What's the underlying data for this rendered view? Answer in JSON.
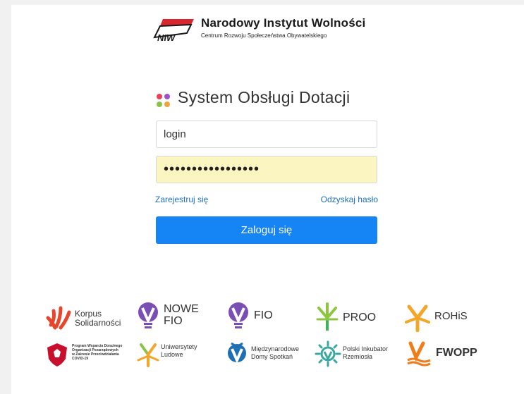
{
  "header": {
    "org_title": "Narodowy Instytut Wolności",
    "org_subtitle": "Centrum Rozwoju Społeczeństwa Obywatelskiego",
    "logo_text": "NIW"
  },
  "app": {
    "title": "System Obsługi Dotacji",
    "dot_colors": [
      "#e8425b",
      "#9d4fd4",
      "#8bc34a",
      "#f2a33a"
    ]
  },
  "form": {
    "login_value": "login",
    "password_value": "•••••••••••••••••",
    "register_link": "Zarejestruj się",
    "recover_link": "Odzyskaj hasło",
    "submit_label": "Zaloguj się"
  },
  "partners": {
    "korpus_line1": "Korpus",
    "korpus_line2": "Solidarności",
    "nowefio_line1": "NOWE",
    "nowefio_line2": "FIO",
    "fio": "FIO",
    "proo": "PROO",
    "rohis": "ROHiS",
    "covid_line1": "Program Wsparcia Doraźnego",
    "covid_line2": "Organizacji Pozarządowych",
    "covid_line3": "w Zakresie Przeciwdziałania",
    "covid_line4": "COVID-19",
    "uniwersytety_line1": "Uniwersytety",
    "uniwersytety_line2": "Ludowe",
    "mds_line1": "Międzynarodowe",
    "mds_line2": "Domy Spotkań",
    "pir_line1": "Polski Inkubator",
    "pir_line2": "Rzemiosła",
    "fwopp": "FWOPP"
  }
}
